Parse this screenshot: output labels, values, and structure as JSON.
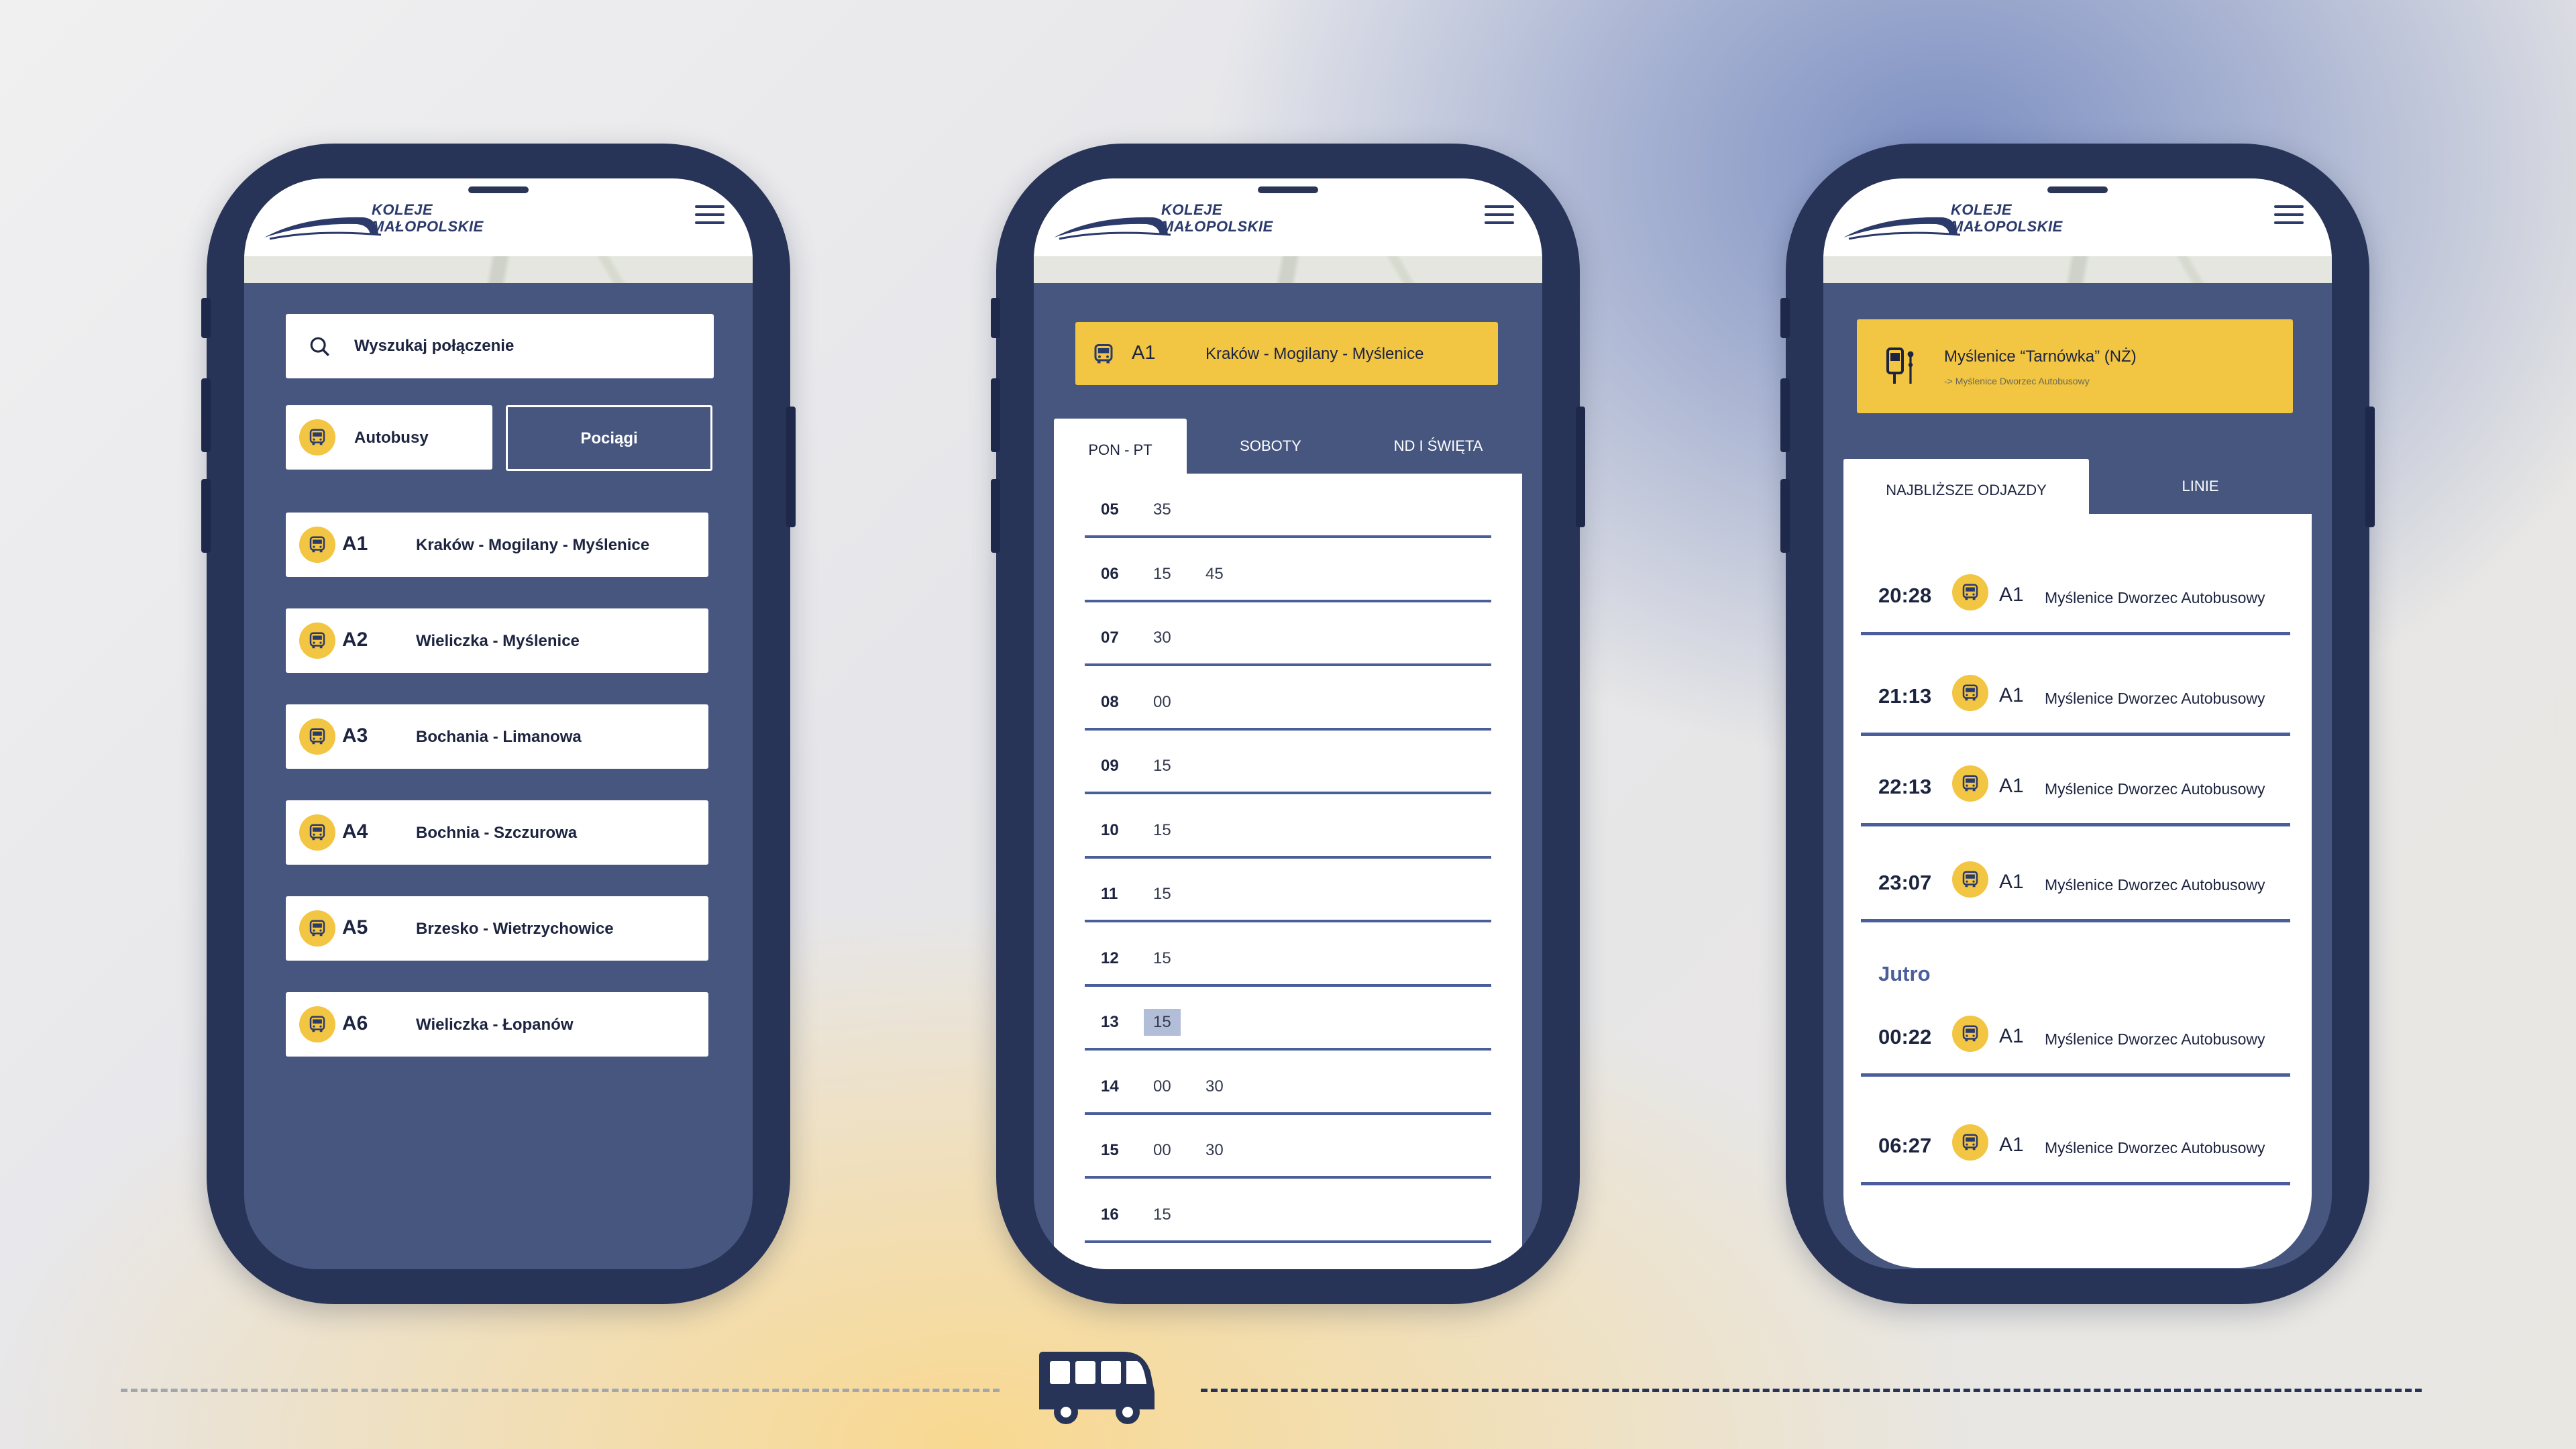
{
  "app": {
    "logo_line1": "KOLEJE",
    "logo_line2": "MAŁOPOLSKIE"
  },
  "screen1": {
    "search_placeholder": "Wyszukaj połączenie",
    "filter_buses": "Autobusy",
    "filter_trains": "Pociągi",
    "routes": [
      {
        "code": "A1",
        "name": "Kraków - Mogilany - Myślenice"
      },
      {
        "code": "A2",
        "name": "Wieliczka - Myślenice"
      },
      {
        "code": "A3",
        "name": "Bochania - Limanowa"
      },
      {
        "code": "A4",
        "name": "Bochnia - Szczurowa"
      },
      {
        "code": "A5",
        "name": "Brzesko - Wietrzychowice"
      },
      {
        "code": "A6",
        "name": "Wieliczka - Łopanów"
      }
    ]
  },
  "screen2": {
    "line_code": "A1",
    "line_name": "Kraków - Mogilany - Myślenice",
    "tabs": [
      "PON - PT",
      "SOBOTY",
      "ND I ŚWIĘTA"
    ],
    "rows": [
      {
        "h": "05",
        "m": [
          "35"
        ]
      },
      {
        "h": "06",
        "m": [
          "15",
          "45"
        ]
      },
      {
        "h": "07",
        "m": [
          "30"
        ]
      },
      {
        "h": "08",
        "m": [
          "00"
        ]
      },
      {
        "h": "09",
        "m": [
          "15"
        ]
      },
      {
        "h": "10",
        "m": [
          "15"
        ]
      },
      {
        "h": "11",
        "m": [
          "15"
        ]
      },
      {
        "h": "12",
        "m": [
          "15"
        ]
      },
      {
        "h": "13",
        "m": [
          "15"
        ],
        "highlight": true
      },
      {
        "h": "14",
        "m": [
          "00",
          "30"
        ]
      },
      {
        "h": "15",
        "m": [
          "00",
          "30"
        ]
      },
      {
        "h": "16",
        "m": [
          "15"
        ]
      }
    ]
  },
  "screen3": {
    "stop_name": "Myślenice “Tarnówka” (NŻ)",
    "stop_direction": "-> Myślenice Dworzec Autobusowy",
    "tabs": [
      "NAJBLIŻSZE ODJAZDY",
      "LINIE"
    ],
    "departures": [
      {
        "time": "20:28",
        "code": "A1",
        "dest": "Myślenice Dworzec Autobusowy"
      },
      {
        "time": "21:13",
        "code": "A1",
        "dest": "Myślenice Dworzec Autobusowy"
      },
      {
        "time": "22:13",
        "code": "A1",
        "dest": "Myślenice Dworzec Autobusowy"
      },
      {
        "time": "23:07",
        "code": "A1",
        "dest": "Myślenice Dworzec Autobusowy"
      }
    ],
    "tomorrow_label": "Jutro",
    "tomorrow_departures": [
      {
        "time": "00:22",
        "code": "A1",
        "dest": "Myślenice Dworzec Autobusowy"
      },
      {
        "time": "06:27",
        "code": "A1",
        "dest": "Myślenice Dworzec Autobusowy"
      }
    ]
  },
  "colors": {
    "navy": "#283457",
    "panel": "#46567f",
    "yellow": "#f2c542",
    "line": "#4a5e9c",
    "highlight": "#b2bdd8"
  },
  "icons": [
    "search-icon",
    "bus-icon",
    "menu-icon",
    "bus-stop-icon",
    "bus-illustration-icon"
  ]
}
